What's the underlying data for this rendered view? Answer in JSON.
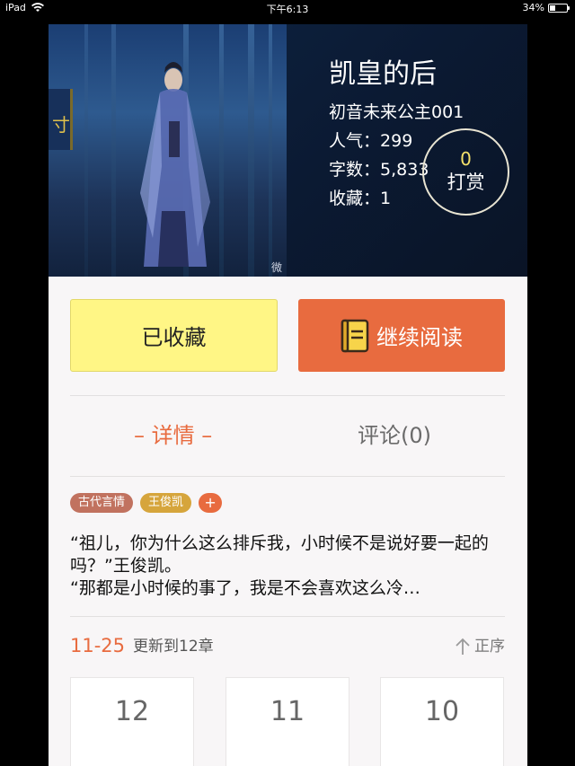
{
  "status_bar": {
    "device": "iPad",
    "time": "下午6:13",
    "battery_text": "34%",
    "battery_level": 0.34
  },
  "book": {
    "title": "凯皇的后",
    "author": "初音未来公主001",
    "stats": [
      {
        "label": "人气：",
        "value": "299"
      },
      {
        "label": "字数：",
        "value": "5,833"
      },
      {
        "label": "收藏：",
        "value": "1"
      }
    ],
    "tip": {
      "count": "0",
      "label": "打赏"
    },
    "cover_watermark": "微"
  },
  "actions": {
    "favorite_label": "已收藏",
    "read_label": "继续阅读"
  },
  "tabs": [
    {
      "label": "– 详情 –",
      "active": true
    },
    {
      "label": "评论(0)",
      "active": false
    }
  ],
  "tags": [
    "古代言情",
    "王俊凯",
    "+"
  ],
  "synopsis": [
    "“祖儿，你为什么这么排斥我，小时候不是说好要一起的吗？”王俊凯。",
    "“那都是小时候的事了，我是不会喜欢这么冷…"
  ],
  "chapters": {
    "date": "11-25",
    "update_text": "更新到12章",
    "sort_label": "正序",
    "items": [
      "12",
      "11",
      "10"
    ]
  },
  "colors": {
    "accent": "#e86b3f",
    "favorite_bg": "#fff685",
    "tip_count": "#f4e16b"
  }
}
